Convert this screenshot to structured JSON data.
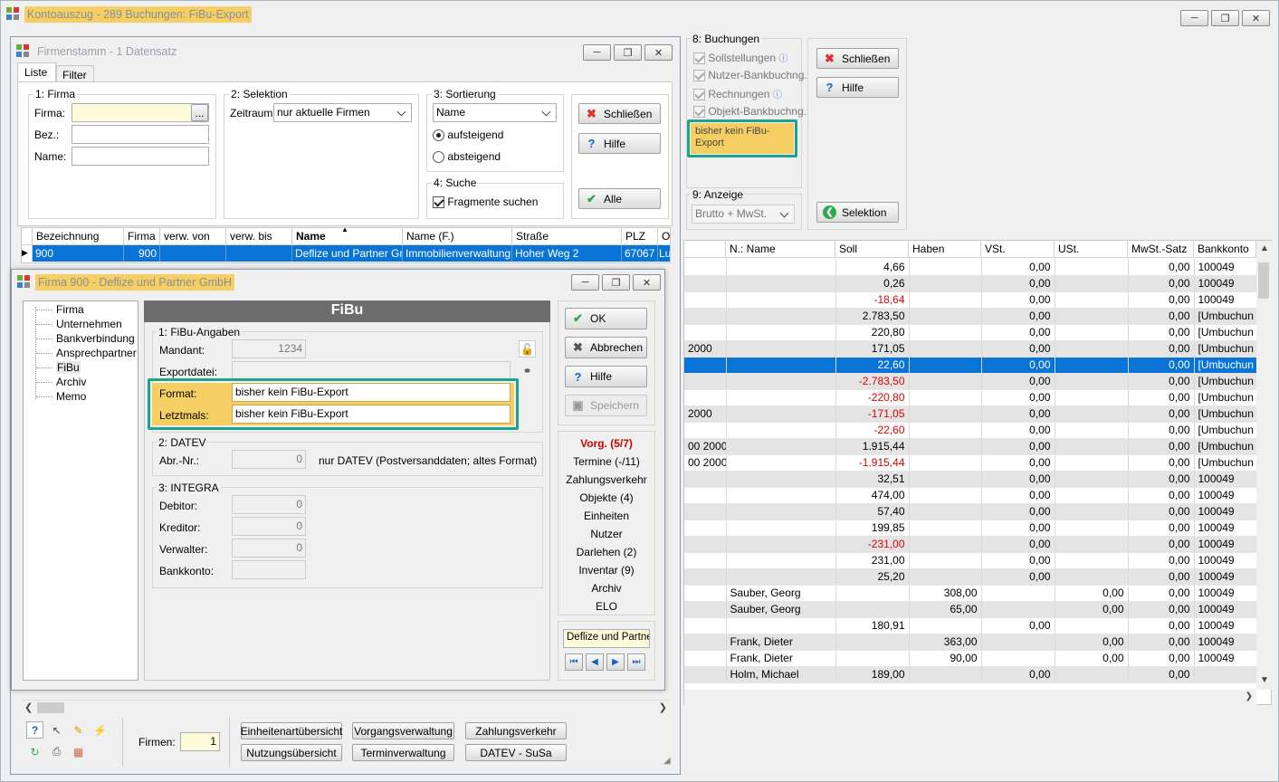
{
  "main_window": {
    "title": "Kontoauszug - 289 Buchungen: FiBu-Export"
  },
  "buchungen": {
    "heading": "8: Buchungen",
    "items": [
      {
        "label": "Sollstellungen",
        "info": true
      },
      {
        "label": "Nutzer-Bankbuchng.",
        "info": false
      },
      {
        "label": "Rechnungen",
        "info": true
      },
      {
        "label": "Objekt-Bankbuchng.",
        "info": false
      }
    ],
    "export_status": "bisher kein FiBu-Export",
    "anzeige_heading": "9: Anzeige",
    "anzeige_value": "Brutto + MwSt."
  },
  "main_buttons": {
    "close": "Schließen",
    "help": "Hilfe",
    "selection": "Selektion"
  },
  "ledger": {
    "columns": [
      "N.: Name",
      "Soll",
      "Haben",
      "VSt.",
      "USt.",
      "MwSt.-Satz",
      "Bankkonto"
    ],
    "rows": [
      {
        "lead": "",
        "name": "",
        "soll": "4,66",
        "haben": "",
        "vst": "0,00",
        "ust": "",
        "mwst": "0,00",
        "bank": "100049",
        "neg": false
      },
      {
        "lead": "",
        "name": "",
        "soll": "0,26",
        "haben": "",
        "vst": "0,00",
        "ust": "",
        "mwst": "0,00",
        "bank": "100049",
        "neg": false
      },
      {
        "lead": "",
        "name": "",
        "soll": "-18,64",
        "haben": "",
        "vst": "0,00",
        "ust": "",
        "mwst": "0,00",
        "bank": "100049",
        "neg": true
      },
      {
        "lead": "",
        "name": "",
        "soll": "2.783,50",
        "haben": "",
        "vst": "0,00",
        "ust": "",
        "mwst": "0,00",
        "bank": "[Umbuchun",
        "neg": false
      },
      {
        "lead": "",
        "name": "",
        "soll": "220,80",
        "haben": "",
        "vst": "0,00",
        "ust": "",
        "mwst": "0,00",
        "bank": "[Umbuchun",
        "neg": false
      },
      {
        "lead": "2000",
        "name": "",
        "soll": "171,05",
        "haben": "",
        "vst": "0,00",
        "ust": "",
        "mwst": "0,00",
        "bank": "[Umbuchun",
        "neg": false
      },
      {
        "lead": "",
        "name": "",
        "soll": "22,60",
        "haben": "",
        "vst": "0,00",
        "ust": "",
        "mwst": "0,00",
        "bank": "[Umbuchun",
        "neg": false,
        "sel": true
      },
      {
        "lead": "",
        "name": "",
        "soll": "-2.783,50",
        "haben": "",
        "vst": "0,00",
        "ust": "",
        "mwst": "0,00",
        "bank": "[Umbuchun",
        "neg": true
      },
      {
        "lead": "",
        "name": "",
        "soll": "-220,80",
        "haben": "",
        "vst": "0,00",
        "ust": "",
        "mwst": "0,00",
        "bank": "[Umbuchun",
        "neg": true
      },
      {
        "lead": "2000",
        "name": "",
        "soll": "-171,05",
        "haben": "",
        "vst": "0,00",
        "ust": "",
        "mwst": "0,00",
        "bank": "[Umbuchun",
        "neg": true
      },
      {
        "lead": "",
        "name": "",
        "soll": "-22,60",
        "haben": "",
        "vst": "0,00",
        "ust": "",
        "mwst": "0,00",
        "bank": "[Umbuchun",
        "neg": true
      },
      {
        "lead": "00 2000",
        "name": "",
        "soll": "1.915,44",
        "haben": "",
        "vst": "0,00",
        "ust": "",
        "mwst": "0,00",
        "bank": "[Umbuchun",
        "neg": false
      },
      {
        "lead": "00 2000",
        "name": "",
        "soll": "-1.915,44",
        "haben": "",
        "vst": "0,00",
        "ust": "",
        "mwst": "0,00",
        "bank": "[Umbuchun",
        "neg": true
      },
      {
        "lead": "",
        "name": "",
        "soll": "32,51",
        "haben": "",
        "vst": "0,00",
        "ust": "",
        "mwst": "0,00",
        "bank": "100049",
        "neg": false
      },
      {
        "lead": "",
        "name": "",
        "soll": "474,00",
        "haben": "",
        "vst": "0,00",
        "ust": "",
        "mwst": "0,00",
        "bank": "100049",
        "neg": false
      },
      {
        "lead": "",
        "name": "",
        "soll": "57,40",
        "haben": "",
        "vst": "0,00",
        "ust": "",
        "mwst": "0,00",
        "bank": "100049",
        "neg": false
      },
      {
        "lead": "",
        "name": "",
        "soll": "199,85",
        "haben": "",
        "vst": "0,00",
        "ust": "",
        "mwst": "0,00",
        "bank": "100049",
        "neg": false
      },
      {
        "lead": "",
        "name": "",
        "soll": "-231,00",
        "haben": "",
        "vst": "0,00",
        "ust": "",
        "mwst": "0,00",
        "bank": "100049",
        "neg": true
      },
      {
        "lead": "",
        "name": "",
        "soll": "231,00",
        "haben": "",
        "vst": "0,00",
        "ust": "",
        "mwst": "0,00",
        "bank": "100049",
        "neg": false
      },
      {
        "lead": "",
        "name": "",
        "soll": "25,20",
        "haben": "",
        "vst": "0,00",
        "ust": "",
        "mwst": "0,00",
        "bank": "100049",
        "neg": false
      },
      {
        "lead": "",
        "name": "Sauber, Georg",
        "soll": "",
        "haben": "308,00",
        "vst": "",
        "ust": "0,00",
        "mwst": "0,00",
        "bank": "100049",
        "neg": false
      },
      {
        "lead": "",
        "name": "Sauber, Georg",
        "soll": "",
        "haben": "65,00",
        "vst": "",
        "ust": "0,00",
        "mwst": "0,00",
        "bank": "100049",
        "neg": false
      },
      {
        "lead": "",
        "name": "",
        "soll": "180,91",
        "haben": "",
        "vst": "0,00",
        "ust": "",
        "mwst": "0,00",
        "bank": "100049",
        "neg": false
      },
      {
        "lead": "",
        "name": "Frank, Dieter",
        "soll": "",
        "haben": "363,00",
        "vst": "",
        "ust": "0,00",
        "mwst": "0,00",
        "bank": "100049",
        "neg": false
      },
      {
        "lead": "",
        "name": "Frank, Dieter",
        "soll": "",
        "haben": "90,00",
        "vst": "",
        "ust": "0,00",
        "mwst": "0,00",
        "bank": "100049",
        "neg": false
      },
      {
        "lead": "",
        "name": "Holm, Michael",
        "soll": "189,00",
        "haben": "",
        "vst": "0,00",
        "ust": "",
        "mwst": "0,00",
        "bank": "",
        "neg": false
      }
    ]
  },
  "firmenstamm": {
    "title": "Firmenstamm - 1 Datensatz",
    "tabs": [
      "Liste",
      "Filter"
    ],
    "firma_group": "1: Firma",
    "firma_label": "Firma:",
    "bez_label": "Bez.:",
    "name_label": "Name:",
    "browse": "...",
    "selektion_group": "2: Selektion",
    "zeitraum_label": "Zeitraum:",
    "zeitraum_value": "nur aktuelle Firmen",
    "sortierung_group": "3: Sortierung",
    "sort_value": "Name",
    "asc": "aufsteigend",
    "desc": "absteigend",
    "suche_group": "4: Suche",
    "fragmente": "Fragmente suchen",
    "close": "Schließen",
    "help": "Hilfe",
    "all": "Alle",
    "columns": [
      "Bezeichnung",
      "Firma",
      "verw. von",
      "verw. bis",
      "Name",
      "Name (F.)",
      "Straße",
      "PLZ",
      "O"
    ],
    "row": {
      "bezeichnung": "900",
      "firma": "900",
      "von": "",
      "bis": "",
      "name": "Deflize und Partner GmbH",
      "name_f": "Immobilienverwaltung",
      "strasse": "Hoher Weg 2",
      "plz": "67067",
      "ort": "Lu"
    },
    "bottom_buttons": [
      "Einheitenartübersicht",
      "Vorgangsverwaltung",
      "Zahlungsverkehr",
      "Nutzungsübersicht",
      "Terminverwaltung",
      "DATEV - SuSa"
    ],
    "firmen_label": "Firmen:",
    "firmen_value": "1"
  },
  "firma_dialog": {
    "title": "Firma 900 - Deflize und Partner GmbH",
    "tree": [
      "Firma",
      "Unternehmen",
      "Bankverbindung",
      "Ansprechpartner",
      "FiBu",
      "Archiv",
      "Memo"
    ],
    "panel_title": "FiBu",
    "fibu_group": "1: FiBu-Angaben",
    "mandant_label": "Mandant:",
    "mandant_value": "1234",
    "exportdatei_label": "Exportdatei:",
    "format_label": "Format:",
    "format_value": "bisher kein FiBu-Export",
    "letztmals_label": "Letztmals:",
    "letztmals_value": "bisher kein FiBu-Export",
    "datev_group": "2: DATEV",
    "abr_label": "Abr.-Nr.:",
    "abr_value": "0",
    "datev_note": "nur DATEV (Postversanddaten; altes Format)",
    "integra_group": "3: INTEGRA",
    "debitor_label": "Debitor:",
    "debitor_value": "0",
    "kreditor_label": "Kreditor:",
    "kreditor_value": "0",
    "verwalter_label": "Verwalter:",
    "verwalter_value": "0",
    "bankkonto_label": "Bankkonto:",
    "buttons": {
      "ok": "OK",
      "cancel": "Abbrechen",
      "help": "Hilfe",
      "save": "Speichern"
    },
    "links": [
      "Vorg. (5/7)",
      "Termine (-/11)",
      "Zahlungsverkehr",
      "Objekte (4)",
      "Einheiten",
      "Nutzer",
      "Darlehen (2)",
      "Inventar (9)",
      "Archiv",
      "ELO"
    ],
    "record_name": "Deflize und Partne"
  },
  "colors": {
    "selection": "#0a74d6",
    "highlight": "#f5cf64",
    "frame": "#1aa58c",
    "negative": "#e00000"
  }
}
